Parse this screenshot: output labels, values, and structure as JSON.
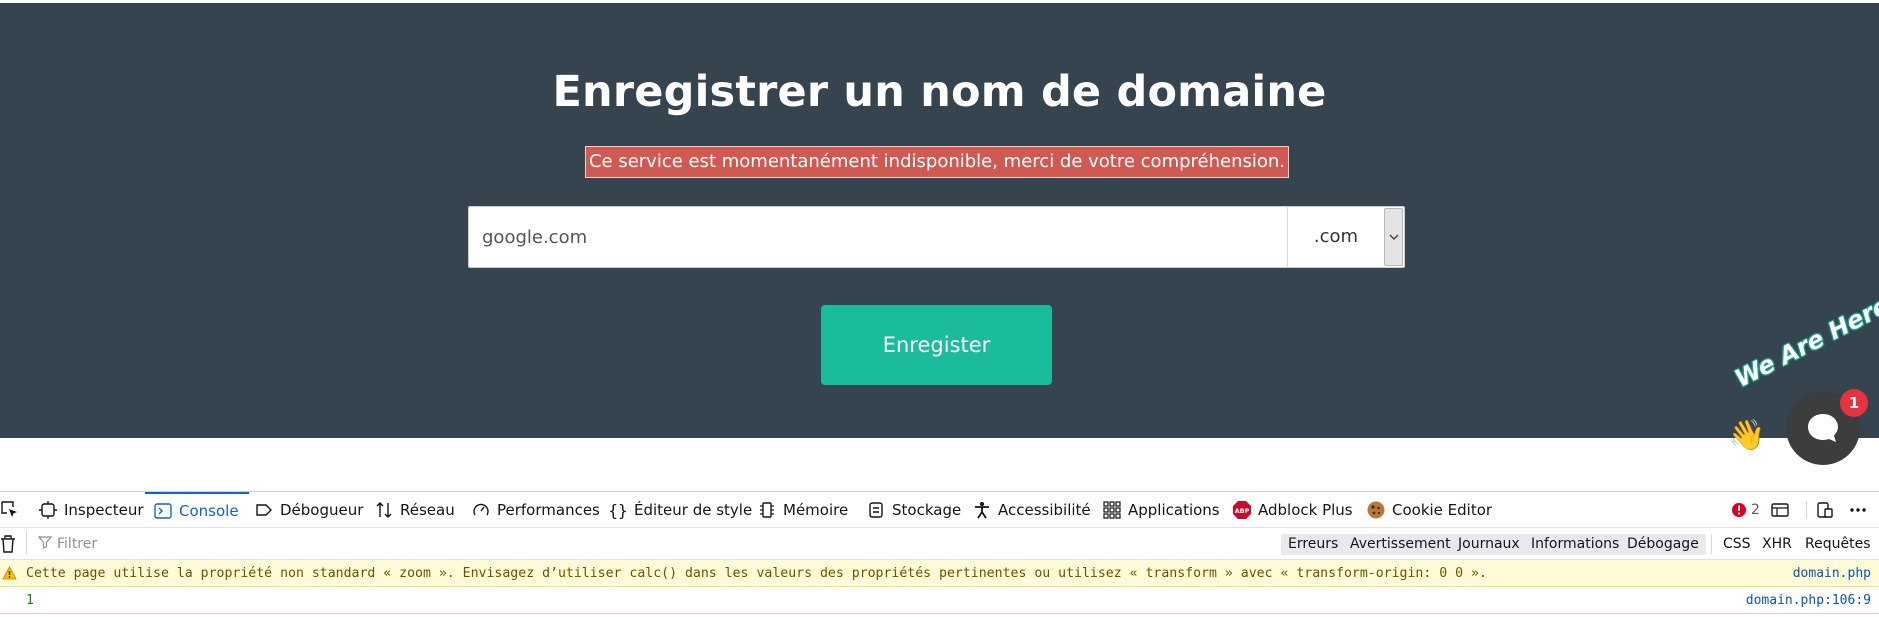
{
  "hero": {
    "title": "Enregistrer un nom de domaine",
    "alert": "Ce service est momentanément indisponible, merci de votre compréhension.",
    "domain_value": "google.com",
    "tld_selected": ".com",
    "submit_label": "Enregister"
  },
  "chat": {
    "tagline": "We Are Here!",
    "badge_count": "1"
  },
  "devtools": {
    "tabs": [
      {
        "label": "Inspecteur",
        "icon": "inspector-icon"
      },
      {
        "label": "Console",
        "icon": "console-icon",
        "active": true
      },
      {
        "label": "Débogueur",
        "icon": "debugger-icon"
      },
      {
        "label": "Réseau",
        "icon": "network-icon"
      },
      {
        "label": "Performances",
        "icon": "performance-icon"
      },
      {
        "label": "Éditeur de style",
        "icon": "style-editor-icon"
      },
      {
        "label": "Mémoire",
        "icon": "memory-icon"
      },
      {
        "label": "Stockage",
        "icon": "storage-icon"
      },
      {
        "label": "Accessibilité",
        "icon": "accessibility-icon"
      },
      {
        "label": "Applications",
        "icon": "applications-icon"
      },
      {
        "label": "Adblock Plus",
        "icon": "adblock-icon"
      },
      {
        "label": "Cookie Editor",
        "icon": "cookie-icon"
      }
    ],
    "error_count": "2",
    "filter_placeholder": "Filtrer",
    "levels": [
      "Erreurs",
      "Avertissements",
      "Journaux",
      "Informations",
      "Débogage"
    ],
    "request_filters": [
      "CSS",
      "XHR",
      "Requêtes"
    ],
    "messages": [
      {
        "type": "warning",
        "text": "Cette page utilise la propriété non standard « zoom ». Envisagez d’utiliser calc() dans les valeurs des propriétés pertinentes ou utilisez « transform » avec « transform-origin: 0 0 ».",
        "source": "domain.php"
      },
      {
        "type": "log",
        "text": "1",
        "source": "domain.php:106:9"
      }
    ],
    "colors": {
      "active_tab": "#0b63d6",
      "error_badge": "#d70022",
      "warning_bg": "#fffbd6"
    }
  }
}
